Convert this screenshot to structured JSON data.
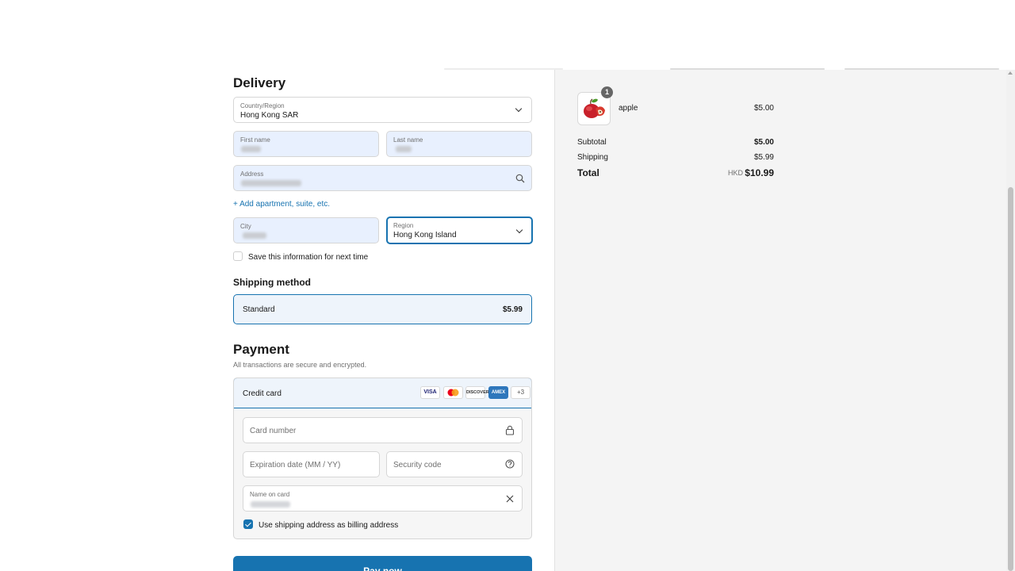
{
  "delivery": {
    "title": "Delivery",
    "country": {
      "label": "Country/Region",
      "value": "Hong Kong SAR"
    },
    "first_name": {
      "label": "First name"
    },
    "last_name": {
      "label": "Last name"
    },
    "address": {
      "label": "Address"
    },
    "add_apartment": "+ Add apartment, suite, etc.",
    "city": {
      "label": "City"
    },
    "region": {
      "label": "Region",
      "value": "Hong Kong Island"
    },
    "save_info": "Save this information for next time"
  },
  "shipping_method": {
    "title": "Shipping method",
    "option_name": "Standard",
    "option_price": "$5.99"
  },
  "payment": {
    "title": "Payment",
    "subtitle": "All transactions are secure and encrypted.",
    "method": "Credit card",
    "card_brands": [
      "VISA",
      "mastercard",
      "DISCOVER",
      "AMEX"
    ],
    "more_cards": "+3",
    "card_number_placeholder": "Card number",
    "expiration_placeholder": "Expiration date (MM / YY)",
    "security_code_placeholder": "Security code",
    "name_on_card_label": "Name on card",
    "billing_same": "Use shipping address as billing address",
    "pay_button": "Pay now"
  },
  "summary": {
    "item": {
      "name": "apple",
      "price": "$5.00",
      "quantity": "1"
    },
    "subtotal_label": "Subtotal",
    "subtotal_value": "$5.00",
    "shipping_label": "Shipping",
    "shipping_value": "$5.99",
    "total_label": "Total",
    "total_currency": "HKD",
    "total_value": "$10.99"
  },
  "colors": {
    "accent": "#1773b0",
    "autofill": "#e8f0fe",
    "panel": "#f4f4f4"
  }
}
